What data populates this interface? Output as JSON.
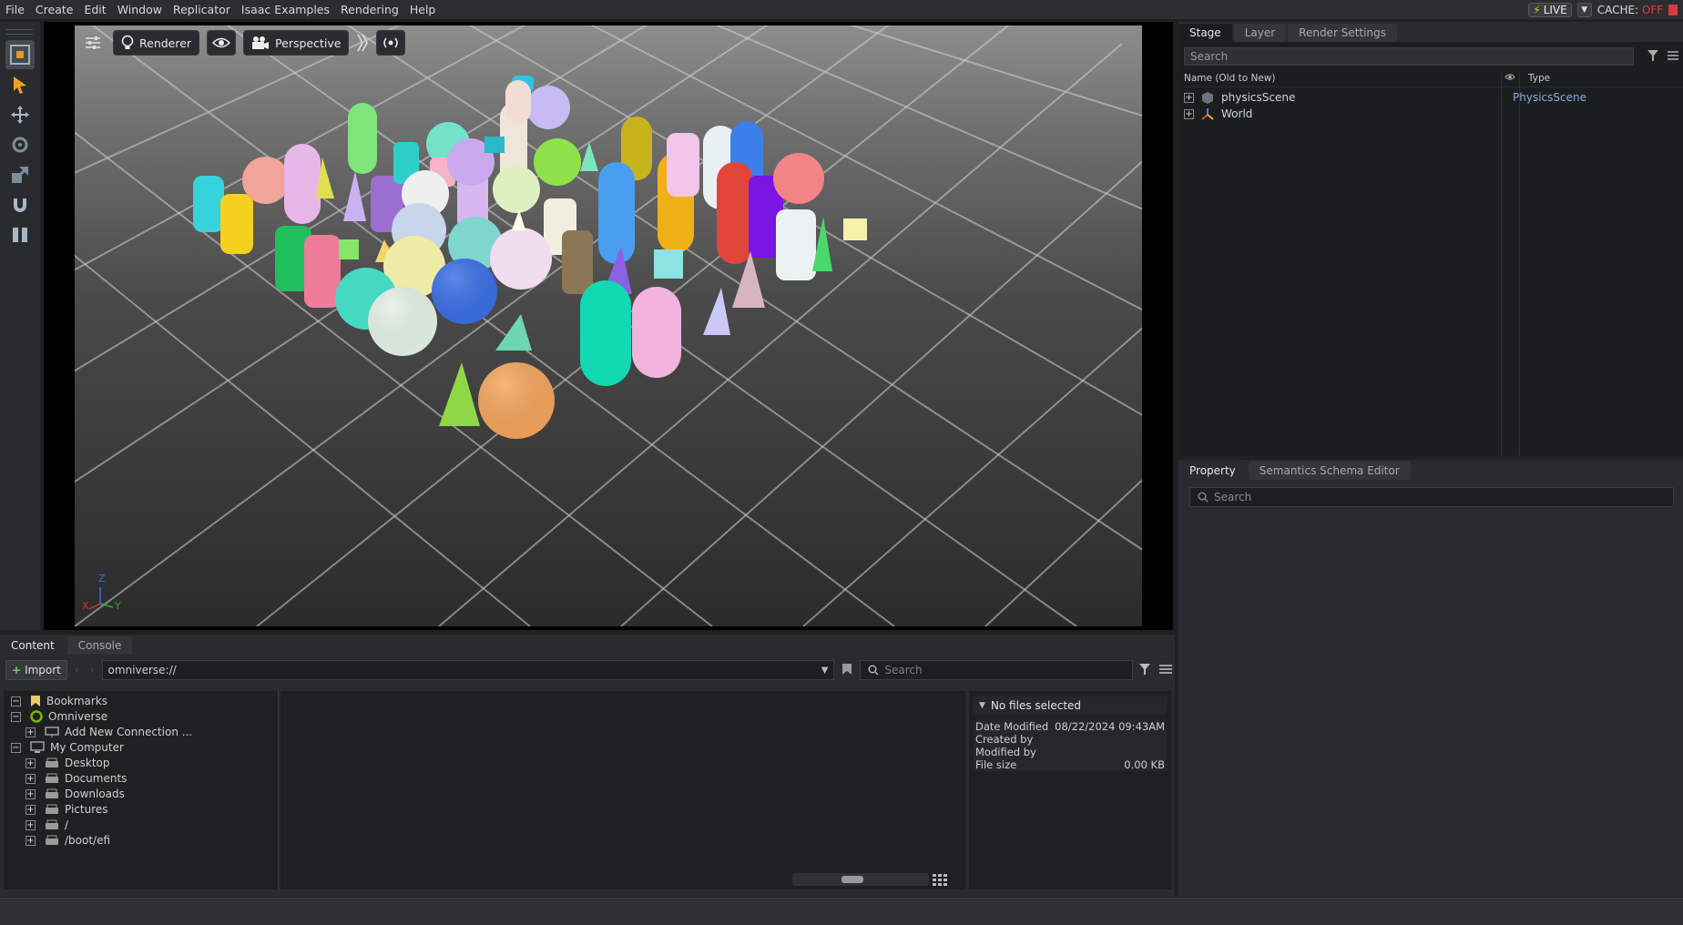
{
  "menu": [
    "File",
    "Create",
    "Edit",
    "Window",
    "Replicator",
    "Isaac Examples",
    "Rendering",
    "Help"
  ],
  "live": {
    "label": "LIVE"
  },
  "cache": {
    "prefix": "CACHE: ",
    "state": "OFF"
  },
  "viewport": {
    "renderer_label": "Renderer",
    "camera_label": "Perspective",
    "axis": {
      "x": "X",
      "y": "Y",
      "z": "Z"
    }
  },
  "stage": {
    "tabs": [
      "Stage",
      "Layer",
      "Render Settings"
    ],
    "search_placeholder": "Search",
    "col_name": "Name (Old to New)",
    "col_type": "Type",
    "rows": [
      {
        "name": "physicsScene",
        "type": "PhysicsScene"
      },
      {
        "name": "World",
        "type": ""
      }
    ]
  },
  "property": {
    "tabs": [
      "Property",
      "Semantics Schema Editor"
    ],
    "search_placeholder": "Search"
  },
  "content": {
    "tabs": [
      "Content",
      "Console"
    ],
    "import_label": "Import",
    "path": "omniverse://",
    "search_placeholder": "Search",
    "tree": [
      {
        "label": "Bookmarks",
        "level": 0
      },
      {
        "label": "Omniverse",
        "level": 0
      },
      {
        "label": "Add New Connection ...",
        "level": 1
      },
      {
        "label": "My Computer",
        "level": 0
      },
      {
        "label": "Desktop",
        "level": 1
      },
      {
        "label": "Documents",
        "level": 1
      },
      {
        "label": "Downloads",
        "level": 1
      },
      {
        "label": "Pictures",
        "level": 1
      },
      {
        "label": "/",
        "level": 1
      },
      {
        "label": "/boot/efi",
        "level": 1
      }
    ],
    "details": {
      "header": "No files selected",
      "date_modified_label": "Date Modified",
      "date_modified": "08/22/2024 09:43AM",
      "created_by_label": "Created by",
      "modified_by_label": "Modified by",
      "file_size_label": "File size",
      "file_size": "0.00 KB"
    }
  }
}
